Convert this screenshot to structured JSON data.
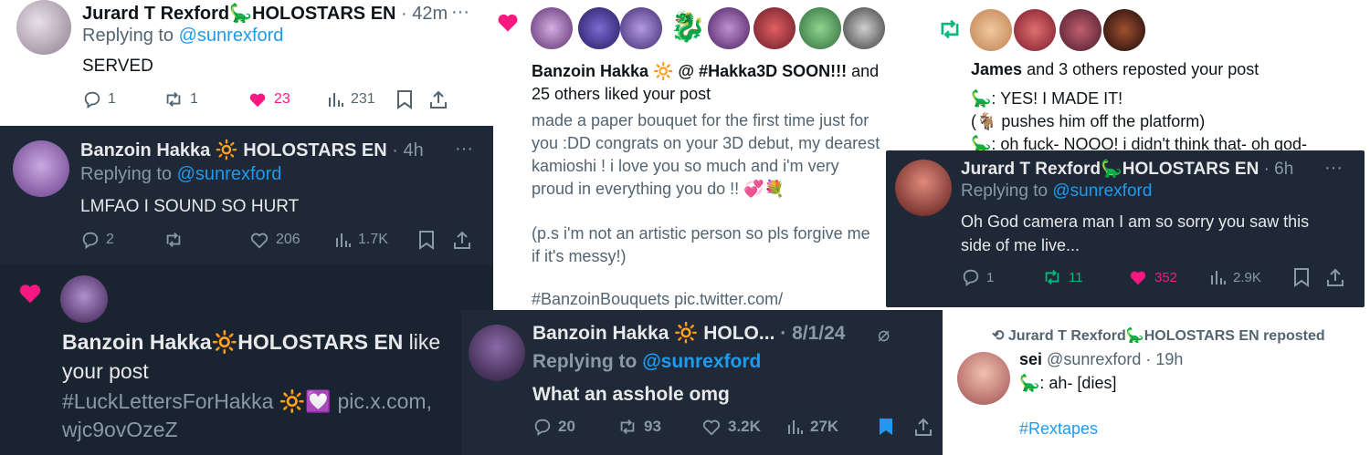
{
  "p1": {
    "name": "Jurard T Rexford",
    "tag": "🦕HOLOSTARS EN",
    "time": "· 42m",
    "replying": "Replying to",
    "handle": "@sunrexford",
    "text": "SERVED",
    "replies": "1",
    "reposts": "1",
    "likes": "23",
    "views": "231"
  },
  "p2": {
    "name": "Banzoin Hakka",
    "tag": "HOLOSTARS EN",
    "time": "· 4h",
    "replying": "Replying to",
    "handle": "@sunrexford",
    "text": "LMFAO I SOUND SO HURT",
    "replies": "2",
    "reposts": "",
    "likes": "206",
    "views": "1.7K"
  },
  "p3": {
    "name": "Banzoin Hakka",
    "tag": "HOLOSTARS EN",
    "suffix": "like",
    "line2": "your post",
    "hashtag": "#LuckLettersForHakka",
    "link": "pic.x.com,",
    "link2": "wjc9ovOzeZ"
  },
  "p4": {
    "name": "Banzoin Hakka",
    "mention": "@ #Hakka3D SOON!!!",
    "suffix": "and",
    "line2": "25 others liked your post",
    "body1": "made a paper bouquet for the first time just for",
    "body2": "you :DD congrats on your 3D debut, my dearest",
    "body3": "kamioshi ! i love you so much and i'm very",
    "body4": "proud in everything you do !! 💞💐",
    "body5": "(p.s i'm not an artistic person so pls forgive me",
    "body6": "if it's messy!)",
    "body7": "#BanzoinBouquets pic.twitter.com/"
  },
  "p5": {
    "name": "Banzoin Hakka",
    "tag": "HOLO...",
    "time": "· 8/1/24",
    "replying": "Replying to",
    "handle": "@sunrexford",
    "text": "What an asshole omg",
    "replies": "20",
    "reposts": "93",
    "likes": "3.2K",
    "views": "27K"
  },
  "p6": {
    "name": "James",
    "suffix": "and 3 others reposted your post",
    "l1": "🦕: YES! I MADE IT!",
    "l2": "(🐐 pushes him off the platform)",
    "l3": "🦕: oh fuck- NOOO! i didn't think that- oh god-"
  },
  "p7": {
    "name": "Jurard T Rexford",
    "tag": "🦕HOLOSTARS EN",
    "time": "· 6h",
    "replying": "Replying to",
    "handle": "@sunrexford",
    "text1": "Oh God camera man I am so sorry you saw this",
    "text2": "side of me live...",
    "replies": "1",
    "reposts": "11",
    "likes": "352",
    "views": "2.9K"
  },
  "p8": {
    "reposted": "Jurard T Rexford🦕HOLOSTARS EN reposted",
    "name": "sei",
    "handle": "@sunrexford",
    "time": "· 19h",
    "text": "🦕: ah- [dies]",
    "hashtag": "#Rextapes"
  },
  "colors": {
    "pink": "#f91880",
    "green": "#00ba7c",
    "blue": "#1d9bf0",
    "dark_bg": "#1e2836"
  }
}
